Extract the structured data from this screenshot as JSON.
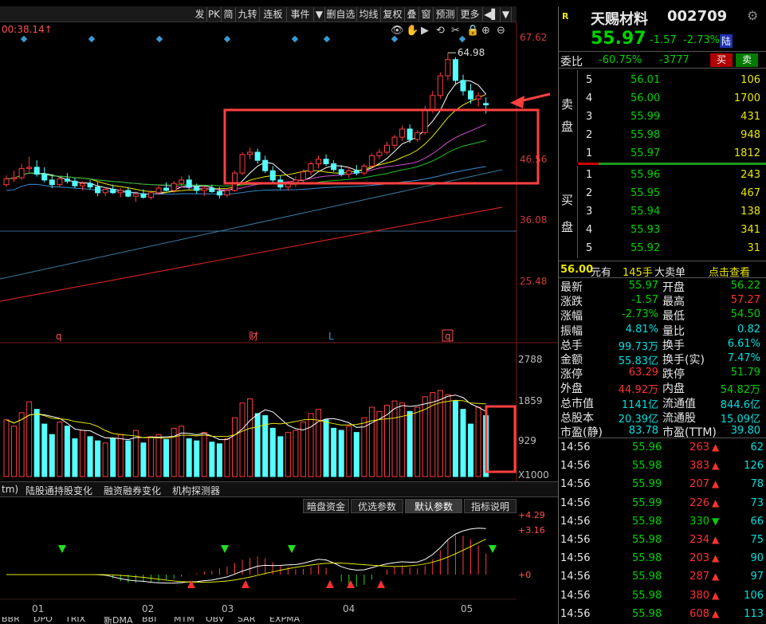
{
  "toolbar": {
    "items": [
      "发",
      "PK",
      "简",
      "九转",
      "连板",
      "事件",
      "▼",
      "删自选",
      "均线",
      "复权",
      "叠",
      "窗",
      "预测",
      "更多",
      "◀▌",
      "▼"
    ]
  },
  "chart": {
    "header_text": "00:38.14↑",
    "y_labels": [
      "67.62",
      "46.56",
      "36.08",
      "25.48"
    ],
    "high_label": "64.98",
    "vol_labels": [
      "2788",
      "1859",
      "929",
      "X1000"
    ],
    "macd_labels": [
      "+4.29",
      "+3.16",
      "+0"
    ],
    "event_marks": [
      "q",
      "财",
      "L",
      "q"
    ],
    "x_labels": [
      "01",
      "02",
      "03",
      "04",
      "05"
    ],
    "indicator_tabs": [
      "tm)",
      "陆股通持股变化",
      "融资融券变化",
      "机构探测器"
    ],
    "param_buttons": [
      "暗盘资金",
      "优选参数",
      "默认参数",
      "指标说明"
    ],
    "active_param": "默认参数",
    "bottom_tabs": [
      "BBR",
      "DPO",
      "TRIX",
      "新DMA",
      "BBI",
      "MTM",
      "OBV",
      "SAR",
      "EXPMA"
    ],
    "candles": [
      [
        42.2,
        43.8,
        41.8,
        43.2
      ],
      [
        43.2,
        44.6,
        42.6,
        43.4
      ],
      [
        43.4,
        45.8,
        43.0,
        45.0
      ],
      [
        45.0,
        47.0,
        44.4,
        45.2
      ],
      [
        45.2,
        46.4,
        43.6,
        44.0
      ],
      [
        44.0,
        45.2,
        42.6,
        43.0
      ],
      [
        43.0,
        43.8,
        41.6,
        42.2
      ],
      [
        42.2,
        43.6,
        41.8,
        43.2
      ],
      [
        43.2,
        44.2,
        42.4,
        42.8
      ],
      [
        42.8,
        43.4,
        41.6,
        42.0
      ],
      [
        42.0,
        42.8,
        41.2,
        42.4
      ],
      [
        42.4,
        43.0,
        41.4,
        41.8
      ],
      [
        41.8,
        42.6,
        40.2,
        40.8
      ],
      [
        40.8,
        41.8,
        40.2,
        41.4
      ],
      [
        41.4,
        42.2,
        40.6,
        40.8
      ],
      [
        40.8,
        41.6,
        40.0,
        41.2
      ],
      [
        41.2,
        41.8,
        40.0,
        40.2
      ],
      [
        40.2,
        41.0,
        39.2,
        40.6
      ],
      [
        40.6,
        41.4,
        39.8,
        40.0
      ],
      [
        40.0,
        41.2,
        39.6,
        40.8
      ],
      [
        40.8,
        42.0,
        40.4,
        41.6
      ],
      [
        41.6,
        42.6,
        41.0,
        41.2
      ],
      [
        41.2,
        42.8,
        40.8,
        42.4
      ],
      [
        42.4,
        43.6,
        41.8,
        43.0
      ],
      [
        43.0,
        43.8,
        41.4,
        41.8
      ],
      [
        41.8,
        42.4,
        40.6,
        41.2
      ],
      [
        41.2,
        42.0,
        40.2,
        41.6
      ],
      [
        41.6,
        42.2,
        40.8,
        41.0
      ],
      [
        41.0,
        41.8,
        39.8,
        40.4
      ],
      [
        40.4,
        41.6,
        40.0,
        41.2
      ],
      [
        41.2,
        44.6,
        41.0,
        44.2
      ],
      [
        44.2,
        47.8,
        43.8,
        47.4
      ],
      [
        47.4,
        48.6,
        46.6,
        47.8
      ],
      [
        47.8,
        48.4,
        45.8,
        46.4
      ],
      [
        46.4,
        47.2,
        44.2,
        44.6
      ],
      [
        44.6,
        45.4,
        42.6,
        43.0
      ],
      [
        43.0,
        43.8,
        41.4,
        41.8
      ],
      [
        41.8,
        42.8,
        41.2,
        42.4
      ],
      [
        42.4,
        43.6,
        41.8,
        43.0
      ],
      [
        43.0,
        44.8,
        42.6,
        44.4
      ],
      [
        44.4,
        46.2,
        43.8,
        45.8
      ],
      [
        45.8,
        47.2,
        45.0,
        46.6
      ],
      [
        46.6,
        47.4,
        45.4,
        45.8
      ],
      [
        45.8,
        46.4,
        44.4,
        44.8
      ],
      [
        44.8,
        45.6,
        43.6,
        44.0
      ],
      [
        44.0,
        45.2,
        43.4,
        44.6
      ],
      [
        44.6,
        45.6,
        43.8,
        44.2
      ],
      [
        44.2,
        45.8,
        43.8,
        45.4
      ],
      [
        45.4,
        47.6,
        45.0,
        47.2
      ],
      [
        47.2,
        48.4,
        46.6,
        47.8
      ],
      [
        47.8,
        49.6,
        47.4,
        49.0
      ],
      [
        49.0,
        50.8,
        48.4,
        50.4
      ],
      [
        50.4,
        52.4,
        49.8,
        51.8
      ],
      [
        51.8,
        52.6,
        49.4,
        50.0
      ],
      [
        50.0,
        51.6,
        49.6,
        51.2
      ],
      [
        51.2,
        55.8,
        50.8,
        55.2
      ],
      [
        55.2,
        58.4,
        54.6,
        57.6
      ],
      [
        57.6,
        61.6,
        57.0,
        61.0
      ],
      [
        61.0,
        64.98,
        60.2,
        63.8
      ],
      [
        63.8,
        64.2,
        59.4,
        60.2
      ],
      [
        60.2,
        61.2,
        57.6,
        58.4
      ],
      [
        58.4,
        59.6,
        56.2,
        57.0
      ],
      [
        57.0,
        58.2,
        55.6,
        57.54
      ],
      [
        56.22,
        57.27,
        54.5,
        55.97
      ]
    ],
    "volumes": [
      1350,
      1200,
      1520,
      1780,
      1600,
      1250,
      1000,
      1300,
      1200,
      900,
      1100,
      950,
      850,
      800,
      900,
      1000,
      850,
      1100,
      800,
      950,
      1000,
      880,
      1150,
      1200,
      900,
      850,
      1050,
      820,
      780,
      900,
      1400,
      1750,
      1850,
      1500,
      1450,
      1150,
      950,
      1050,
      1100,
      1300,
      1500,
      1600,
      1350,
      1150,
      1100,
      1200,
      1050,
      1400,
      1650,
      1550,
      1700,
      1800,
      1750,
      1550,
      1650,
      1900,
      2000,
      2050,
      1950,
      1800,
      1600,
      1250,
      1650,
      1450
    ]
  },
  "quote": {
    "badge": "R",
    "name": "天赐材料",
    "code": "002709",
    "price": "55.97",
    "change": "-1.57",
    "change_pct": "-2.73%",
    "tag": "陆",
    "weibi_label": "委比",
    "weibi": "-60.75%",
    "weicha": "-3777",
    "buy_btn": "买",
    "sell_btn": "卖"
  },
  "sell_orders": [
    {
      "lvl": "5",
      "price": "56.01",
      "vol": "106"
    },
    {
      "lvl": "4",
      "price": "56.00",
      "vol": "1700"
    },
    {
      "lvl": "3",
      "price": "55.99",
      "vol": "431"
    },
    {
      "lvl": "2",
      "price": "55.98",
      "vol": "948"
    },
    {
      "lvl": "1",
      "price": "55.97",
      "vol": "1812"
    }
  ],
  "buy_orders": [
    {
      "lvl": "1",
      "price": "55.96",
      "vol": "243"
    },
    {
      "lvl": "2",
      "price": "55.95",
      "vol": "467"
    },
    {
      "lvl": "3",
      "price": "55.94",
      "vol": "138"
    },
    {
      "lvl": "4",
      "price": "55.93",
      "vol": "341"
    },
    {
      "lvl": "5",
      "price": "55.92",
      "vol": "31"
    }
  ],
  "sell_side_label": [
    "卖",
    "盘"
  ],
  "buy_side_label": [
    "买",
    "盘"
  ],
  "big_order": {
    "price": "56.00",
    "unit": "元有",
    "vol": "145手",
    "label": "大卖单",
    "link": "点击查看"
  },
  "stats": [
    [
      "最新",
      "55.97",
      "开盘",
      "56.22"
    ],
    [
      "涨跌",
      "-1.57",
      "最高",
      "57.27"
    ],
    [
      "涨幅",
      "-2.73%",
      "最低",
      "54.50"
    ],
    [
      "振幅",
      "4.81%",
      "量比",
      "0.82"
    ],
    [
      "总手",
      "99.73万",
      "换手",
      "6.61%"
    ],
    [
      "金额",
      "55.83亿",
      "换手(实)",
      "7.47%"
    ],
    [
      "涨停",
      "63.29",
      "跌停",
      "51.79"
    ],
    [
      "外盘",
      "44.92万",
      "内盘",
      "54.82万"
    ],
    [
      "总市值",
      "1141亿",
      "流通值",
      "844.6亿"
    ],
    [
      "总股本",
      "20.39亿",
      "流通股",
      "15.09亿"
    ],
    [
      "市盈(静)",
      "83.78",
      "市盈(TTM)",
      "39.80"
    ]
  ],
  "ticks": [
    {
      "time": "14:56",
      "price": "55.96",
      "vol": "263",
      "dir": "up",
      "n": "62"
    },
    {
      "time": "14:56",
      "price": "55.98",
      "vol": "383",
      "dir": "up",
      "n": "126"
    },
    {
      "time": "14:56",
      "price": "55.99",
      "vol": "207",
      "dir": "up",
      "n": "78"
    },
    {
      "time": "14:56",
      "price": "55.99",
      "vol": "226",
      "dir": "up",
      "n": "73"
    },
    {
      "time": "14:56",
      "price": "55.98",
      "vol": "330",
      "dir": "down",
      "n": "66"
    },
    {
      "time": "14:56",
      "price": "55.98",
      "vol": "234",
      "dir": "up",
      "n": "75"
    },
    {
      "time": "14:56",
      "price": "55.98",
      "vol": "203",
      "dir": "up",
      "n": "90"
    },
    {
      "time": "14:56",
      "price": "55.98",
      "vol": "287",
      "dir": "up",
      "n": "97"
    },
    {
      "time": "14:56",
      "price": "55.98",
      "vol": "380",
      "dir": "up",
      "n": "106"
    },
    {
      "time": "14:56",
      "price": "55.98",
      "vol": "608",
      "dir": "up",
      "n": "113"
    }
  ]
}
